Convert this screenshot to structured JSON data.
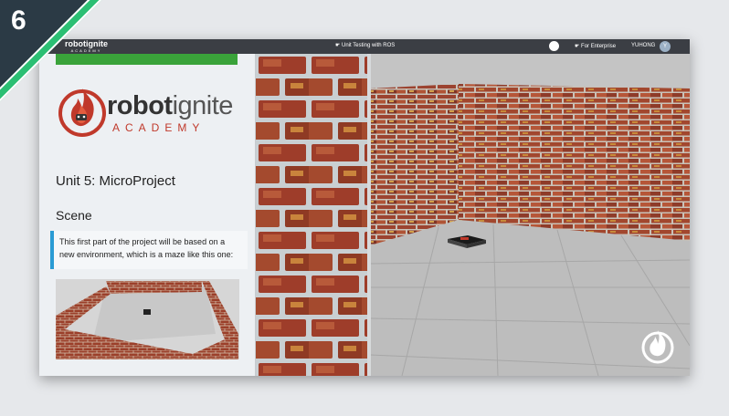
{
  "badge": {
    "number": "6"
  },
  "topbar": {
    "logo_main": "robotignite",
    "logo_sub": "ACADEMY",
    "course_title": "☛ Unit Testing with ROS",
    "enterprise": "☛ For Enterprise",
    "username": "YUHONG",
    "avatar_text": "Y"
  },
  "sidebar": {
    "brand_main_a": "robot",
    "brand_main_b": "ignite",
    "brand_sub": "ACADEMY",
    "unit_title": "Unit 5: MicroProject",
    "section_title": "Scene",
    "intro_text": "This first part of the project will be based on a new environment, which is a maze like this one:"
  },
  "colors": {
    "accent_blue": "#2a9bd4",
    "brand_red": "#c0392b",
    "topbar_bg": "#3b3e44",
    "brick": "#a2472e"
  }
}
